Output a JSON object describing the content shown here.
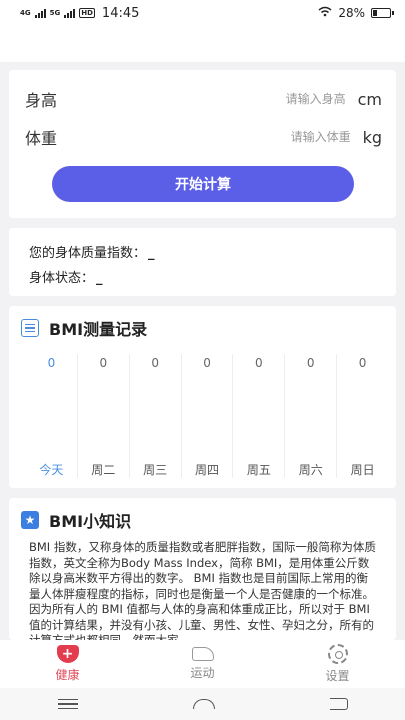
{
  "status": {
    "net1": "4G",
    "net2": "5G",
    "hd": "HD",
    "time": "14:45",
    "battery": "28%",
    "battery_level": 0.28
  },
  "input": {
    "height_label": "身高",
    "height_placeholder": "请输入身高",
    "height_unit": "cm",
    "weight_label": "体重",
    "weight_placeholder": "请输入体重",
    "weight_unit": "kg",
    "start_button": "开始计算"
  },
  "result": {
    "bmi_label": "您的身体质量指数：",
    "bmi_value": "_",
    "state_label": "身体状态：",
    "state_value": "_"
  },
  "record": {
    "title": "BMI测量记录",
    "days": [
      {
        "name": "今天",
        "value": "0"
      },
      {
        "name": "周二",
        "value": "0"
      },
      {
        "name": "周三",
        "value": "0"
      },
      {
        "name": "周四",
        "value": "0"
      },
      {
        "name": "周五",
        "value": "0"
      },
      {
        "name": "周六",
        "value": "0"
      },
      {
        "name": "周日",
        "value": "0"
      }
    ]
  },
  "knowledge": {
    "title": "BMI小知识",
    "text": "BMI 指数，又称身体的质量指数或者肥胖指数，国际一般简称为体质指数，英文全称为Body Mass Index，简称 BMI，是用体重公斤数除以身高米数平方得出的数字。 BMI 指数也是目前国际上常用的衡量人体胖瘦程度的指标，同时也是衡量一个人是否健康的一个标准。因为所有人的 BMI 值都与人体的身高和体重成正比，所以对于 BMI 值的计算结果，并没有小孩、儿童、男性、女性、孕妇之分，所有的计算方式也都相同，然而大家"
  },
  "tabs": [
    {
      "label": "健康",
      "icon": "heart-icon",
      "active": true
    },
    {
      "label": "运动",
      "icon": "shoe-icon",
      "active": false
    },
    {
      "label": "设置",
      "icon": "gear-icon",
      "active": false
    }
  ],
  "colors": {
    "accent": "#5b5ee6",
    "today": "#4a90e2",
    "active_tab": "#e24a5a"
  }
}
